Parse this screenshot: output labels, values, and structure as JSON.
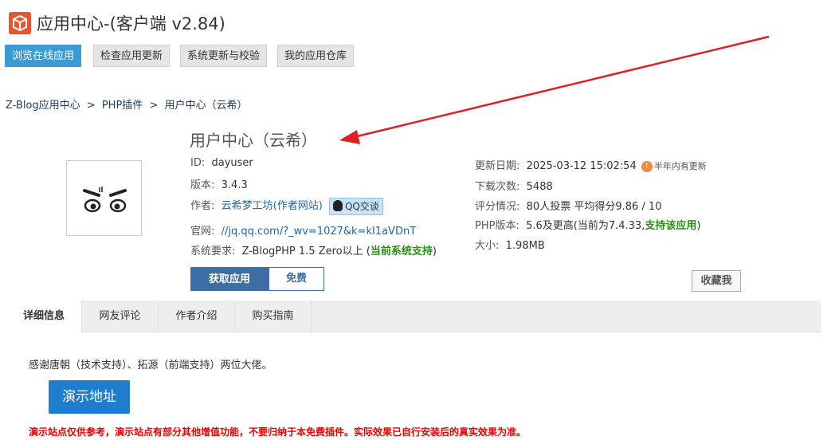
{
  "header": {
    "title": "应用中心-(客户端 v2.84)",
    "logo_icon": "app-center-logo-icon",
    "accent_color": "#e4572e"
  },
  "toolbar": {
    "buttons": [
      {
        "label": "浏览在线应用",
        "active": true
      },
      {
        "label": "检查应用更新",
        "active": false
      },
      {
        "label": "系统更新与校验",
        "active": false
      },
      {
        "label": "我的应用仓库",
        "active": false
      }
    ]
  },
  "breadcrumb": {
    "items": [
      "Z-Blog应用中心",
      ">",
      "PHP插件",
      ">",
      "用户中心（云希）"
    ]
  },
  "plugin": {
    "title": "用户中心（云希）",
    "id_label": "ID:",
    "id_value": "dayuser",
    "version_label": "版本:",
    "version_value": "3.4.3",
    "author_label": "作者:",
    "author_value": "云希梦工坊(作者网站)",
    "qq_label": "QQ交谈",
    "website_label": "官网:",
    "website_value": "//jq.qq.com/?_wv=1027&k=kI1aVDnT",
    "requirement_label": "系统要求:",
    "requirement_value": "Z-BlogPHP 1.5 Zero以上 (",
    "requirement_status": "当前系统支持",
    "requirement_close": ")",
    "update_date_label": "更新日期:",
    "update_date_value": "2025-03-12 15:02:54",
    "update_badge": "!",
    "update_note": "半年内有更新",
    "downloads_label": "下载次数:",
    "downloads_value": "5488",
    "rating_label": "评分情况:",
    "rating_value": "80人投票 平均得分9.86 / 10",
    "php_label": "PHP版本:",
    "php_value": "5.6及更高(当前为7.4.33,",
    "php_status": "支持该应用",
    "php_close": ")",
    "size_label": "大小:",
    "size_value": "1.98MB"
  },
  "actions": {
    "get_app": "获取应用",
    "free": "免费",
    "favorite": "收藏我"
  },
  "tabs": [
    {
      "label": "详细信息",
      "active": true
    },
    {
      "label": "网友评论",
      "active": false
    },
    {
      "label": "作者介绍",
      "active": false
    },
    {
      "label": "购买指南",
      "active": false
    }
  ],
  "content": {
    "thanks": "感谢唐朝（技术支持）、拓源（前端支持）两位大佬。",
    "demo_button": "演示地址",
    "demo_note": "演示站点仅供参考，演示站点有部分其他增值功能，不要归纳于本免费插件。实际效果已自行安装后的真实效果为准。"
  }
}
